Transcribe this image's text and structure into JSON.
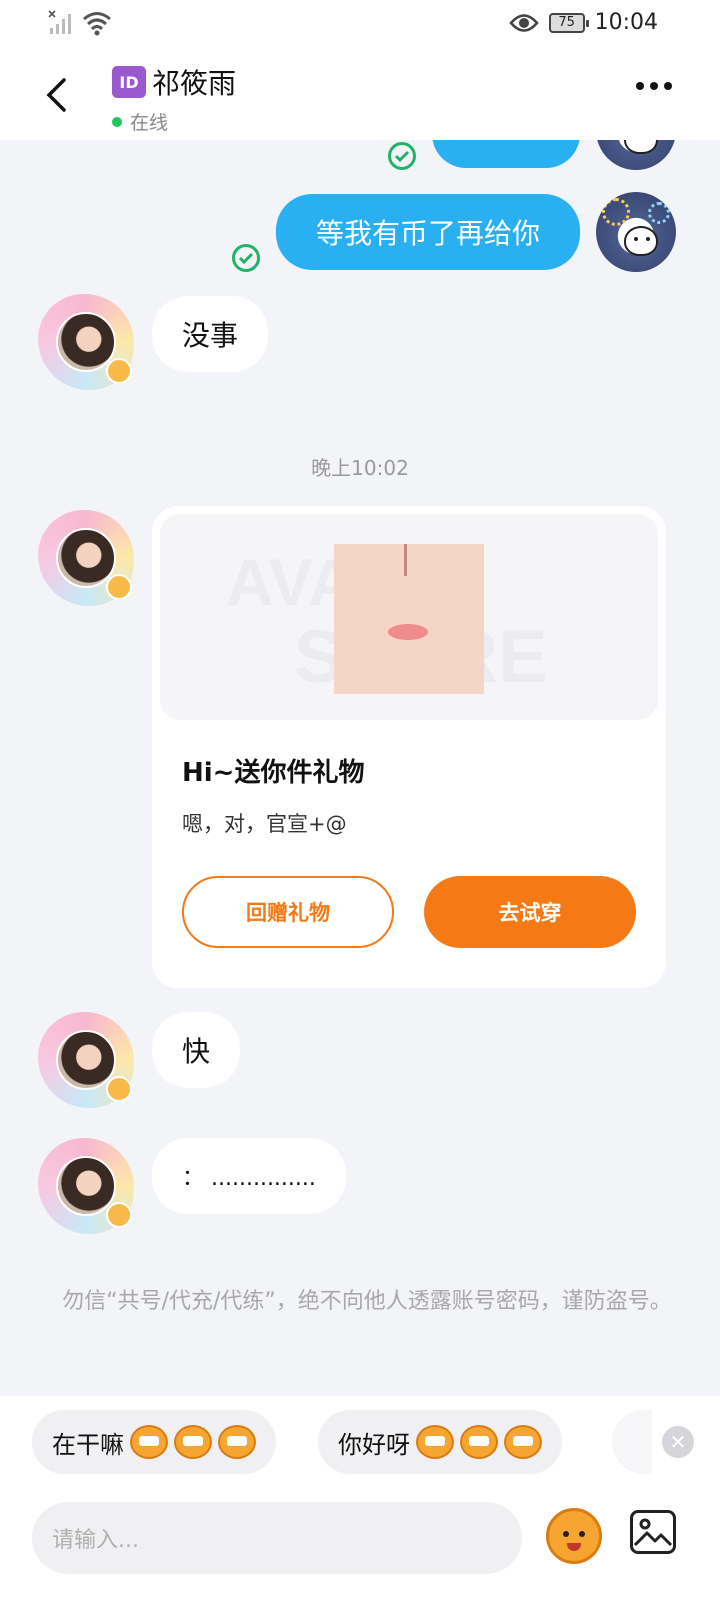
{
  "status_bar": {
    "time": "10:04",
    "battery": "75",
    "icons": [
      "signal-off-icon",
      "wifi-icon",
      "eye-icon",
      "battery-icon"
    ]
  },
  "header": {
    "id_badge": "ID",
    "title": "祁筱雨",
    "status": "在线",
    "back_icon": "chevron-left-icon",
    "more_icon": "more-dots-icon"
  },
  "messages": {
    "partial_top": "",
    "sent_1": "等我有币了再给你",
    "recv_1": "没事",
    "timestamp": "晚上10:02",
    "gift": {
      "watermark_1": "AVATAR",
      "watermark_2": "STORE",
      "title": "Hi~送你件礼物",
      "desc": "嗯，对，官宣+@",
      "btn_return": "回赠礼物",
      "btn_try": "去试穿"
    },
    "recv_2": "快",
    "recv_3": "：  ..............."
  },
  "warning": "勿信“共号/代充/代练”，绝不向他人透露账号密码，谨防盗号。",
  "quick_replies": [
    {
      "label": "在干嘛"
    },
    {
      "label": "你好呀"
    }
  ],
  "input": {
    "placeholder": "请输入..."
  },
  "colors": {
    "accent_blue": "#29b0f3",
    "accent_orange": "#f57a16",
    "online_green": "#22c55e",
    "check_green": "#22b36a"
  }
}
